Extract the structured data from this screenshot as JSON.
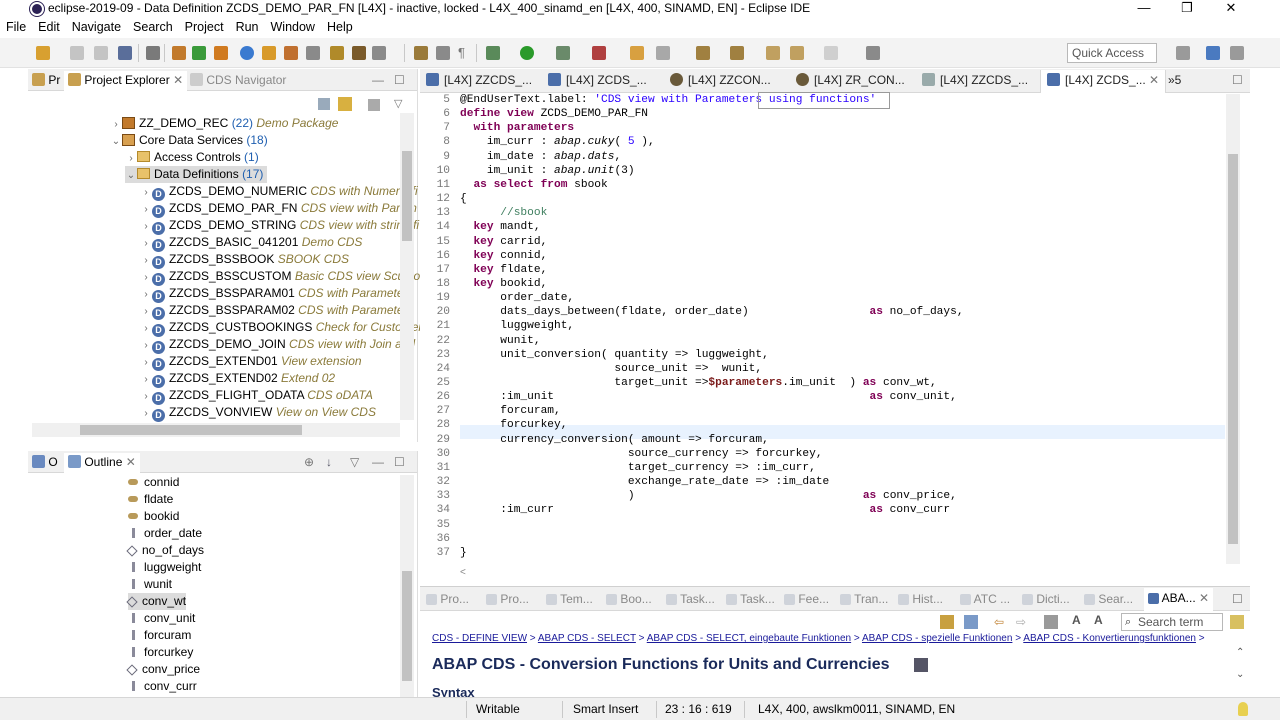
{
  "window": {
    "title": "eclipse-2019-09 - Data Definition ZCDS_DEMO_PAR_FN [L4X] - inactive, locked - L4X_400_sinamd_en [L4X, 400, SINAMD, EN] - Eclipse IDE",
    "minimize": "—",
    "restore": "❐",
    "close": "✕"
  },
  "menu": [
    "File",
    "Edit",
    "Navigate",
    "Search",
    "Project",
    "Run",
    "Window",
    "Help"
  ],
  "toolbar": {
    "quick_access": "Quick Access"
  },
  "project_explorer": {
    "tabs": [
      "Pr",
      "Project Explorer",
      "CDS Navigator"
    ],
    "package": {
      "name": "ZZ_DEMO_REC",
      "count": "(22)",
      "desc": "Demo Package"
    },
    "core": {
      "name": "Core Data Services",
      "count": "(18)"
    },
    "access": {
      "name": "Access Controls",
      "count": "(1)"
    },
    "defs": {
      "name": "Data Definitions",
      "count": "(17)"
    },
    "items": [
      {
        "name": "ZCDS_DEMO_NUMERIC",
        "desc": "CDS with Numeric fi"
      },
      {
        "name": "ZCDS_DEMO_PAR_FN",
        "desc": "CDS view with Param"
      },
      {
        "name": "ZCDS_DEMO_STRING",
        "desc": "CDS view with string fi"
      },
      {
        "name": "ZZCDS_BASIC_041201",
        "desc": "Demo CDS"
      },
      {
        "name": "ZZCDS_BSSBOOK",
        "desc": "SBOOK CDS"
      },
      {
        "name": "ZZCDS_BSSCUSTOM",
        "desc": "Basic CDS view Scuston"
      },
      {
        "name": "ZZCDS_BSSPARAM01",
        "desc": "CDS with Parameters"
      },
      {
        "name": "ZZCDS_BSSPARAM02",
        "desc": "CDS with Parameters"
      },
      {
        "name": "ZZCDS_CUSTBOOKINGS",
        "desc": "Check for Customer"
      },
      {
        "name": "ZZCDS_DEMO_JOIN",
        "desc": "CDS view with Join and"
      },
      {
        "name": "ZZCDS_EXTEND01",
        "desc": "View extension"
      },
      {
        "name": "ZZCDS_EXTEND02",
        "desc": "Extend 02"
      },
      {
        "name": "ZZCDS_FLIGHT_ODATA",
        "desc": "CDS oDATA"
      },
      {
        "name": "ZZCDS_VONVIEW",
        "desc": "View on View CDS"
      }
    ]
  },
  "outline": {
    "tabs": [
      "O",
      "Outline"
    ],
    "items": [
      "connid",
      "fldate",
      "bookid",
      "order_date",
      "no_of_days",
      "luggweight",
      "wunit",
      "conv_wt",
      "conv_unit",
      "forcuram",
      "forcurkey",
      "conv_price",
      "conv_curr"
    ]
  },
  "editor": {
    "tabs": [
      "[L4X] ZZCDS_...",
      "[L4X] ZCDS_...",
      "[L4X] ZZCON...",
      "[L4X] ZR_CON...",
      "[L4X] ZZCDS_...",
      "[L4X] ZCDS_..."
    ],
    "overflow": "»5",
    "lines": [
      {
        "n": "5",
        "t": "@EndUserText.label: 'CDS view with Parameters using functions'"
      },
      {
        "n": "6",
        "t": "define view ZCDS_DEMO_PAR_FN"
      },
      {
        "n": "7",
        "t": "  with parameters"
      },
      {
        "n": "8",
        "t": "    im_curr : abap.cuky( 5 ),"
      },
      {
        "n": "9",
        "t": "    im_date : abap.dats,"
      },
      {
        "n": "10",
        "t": "    im_unit : abap.unit(3)"
      },
      {
        "n": "11",
        "t": "  as select from sbook"
      },
      {
        "n": "12",
        "t": "{"
      },
      {
        "n": "13",
        "t": "      //sbook"
      },
      {
        "n": "14",
        "t": "  key mandt,"
      },
      {
        "n": "15",
        "t": "  key carrid,"
      },
      {
        "n": "16",
        "t": "  key connid,"
      },
      {
        "n": "17",
        "t": "  key fldate,"
      },
      {
        "n": "18",
        "t": "  key bookid,"
      },
      {
        "n": "19",
        "t": "      order_date,"
      },
      {
        "n": "20",
        "t": "      dats_days_between(fldate, order_date)                  as no_of_days,"
      },
      {
        "n": "21",
        "t": "      luggweight,"
      },
      {
        "n": "22",
        "t": "      wunit,"
      },
      {
        "n": "23",
        "t": "      unit_conversion( quantity => luggweight,"
      },
      {
        "n": "24",
        "t": "                       source_unit =>  wunit,"
      },
      {
        "n": "25",
        "t": "                       target_unit =>$parameters.im_unit  ) as conv_wt,"
      },
      {
        "n": "26",
        "t": "      :im_unit                                               as conv_unit,"
      },
      {
        "n": "27",
        "t": "      forcuram,"
      },
      {
        "n": "28",
        "t": "      forcurkey,"
      },
      {
        "n": "29",
        "t": "      currency_conversion( amount => forcuram,"
      },
      {
        "n": "30",
        "t": "                         source_currency => forcurkey,"
      },
      {
        "n": "31",
        "t": "                         target_currency => :im_curr,"
      },
      {
        "n": "32",
        "t": "                         exchange_rate_date => :im_date"
      },
      {
        "n": "33",
        "t": "                         )                                  as conv_price,"
      },
      {
        "n": "34",
        "t": "      :im_curr                                               as conv_curr"
      },
      {
        "n": "35",
        "t": ""
      },
      {
        "n": "36",
        "t": ""
      },
      {
        "n": "37",
        "t": "}"
      }
    ]
  },
  "bottom": {
    "tabs": [
      "Pro...",
      "Pro...",
      "Tem...",
      "Boo...",
      "Task...",
      "Task...",
      "Fee...",
      "Tran...",
      "Hist...",
      "ATC ...",
      "Dicti...",
      "Sear...",
      "ABA..."
    ],
    "search_placeholder": "Search term",
    "breadcrumbs": [
      "CDS - DEFINE VIEW",
      "ABAP CDS - SELECT",
      "ABAP CDS - SELECT, eingebaute Funktionen",
      "ABAP CDS - spezielle Funktionen",
      "ABAP CDS - Konvertierungsfunktionen"
    ],
    "title": "ABAP CDS - Conversion Functions for Units and Currencies",
    "syntax": "Syntax"
  },
  "status": {
    "writable": "Writable",
    "insert": "Smart Insert",
    "position": "23 : 16 : 619",
    "system": "L4X, 400, awslkm0011, SINAMD, EN"
  },
  "colors": {
    "keyword": "#7f0055",
    "comment": "#3f7f5f",
    "string": "#2a00ff",
    "desc": "#8a7a3a",
    "link": "#1a1a9a"
  }
}
